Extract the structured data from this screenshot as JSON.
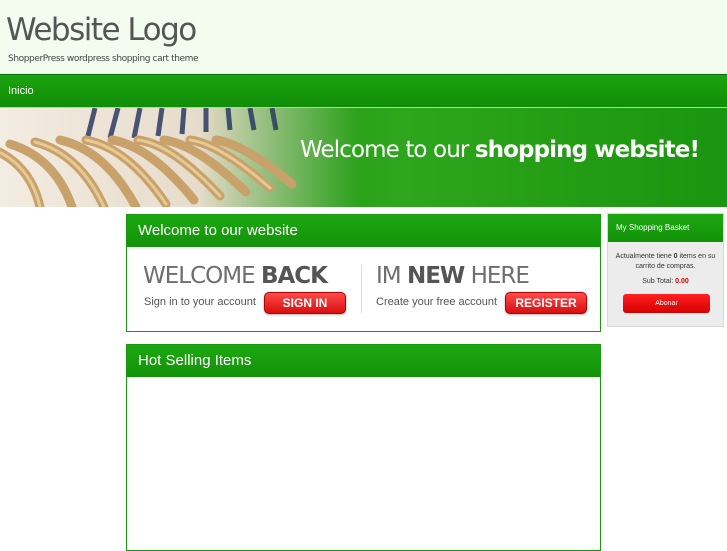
{
  "header": {
    "logo": "Website Logo",
    "tagline": "ShopperPress wordpress shopping cart theme"
  },
  "nav": {
    "items": [
      "Inicio"
    ]
  },
  "banner": {
    "text_regular": "Welcome to our ",
    "text_bold": "shopping website!"
  },
  "welcome_panel": {
    "title": "Welcome to our website",
    "back": {
      "heading_regular": "WELCOME ",
      "heading_bold": "BACK",
      "subtext": "Sign in to your account",
      "button": "SIGN IN"
    },
    "new": {
      "heading_regular_1": "IM ",
      "heading_bold": "NEW",
      "heading_regular_2": " HERE",
      "subtext": "Create your free account",
      "button": "REGISTER"
    }
  },
  "hot_panel": {
    "title": "Hot Selling Items"
  },
  "basket": {
    "title": "My Shopping Basket",
    "line1": "Actualmente tiene ",
    "count": "0",
    "line2": " items en su carrito de compras.",
    "subtotal_label": "Sub Total: ",
    "subtotal_value": "0.00",
    "button": "Abonar"
  },
  "colors": {
    "brand_green": "#139209",
    "accent_red": "#d80e0e",
    "header_bg": "#f2fdf0"
  }
}
